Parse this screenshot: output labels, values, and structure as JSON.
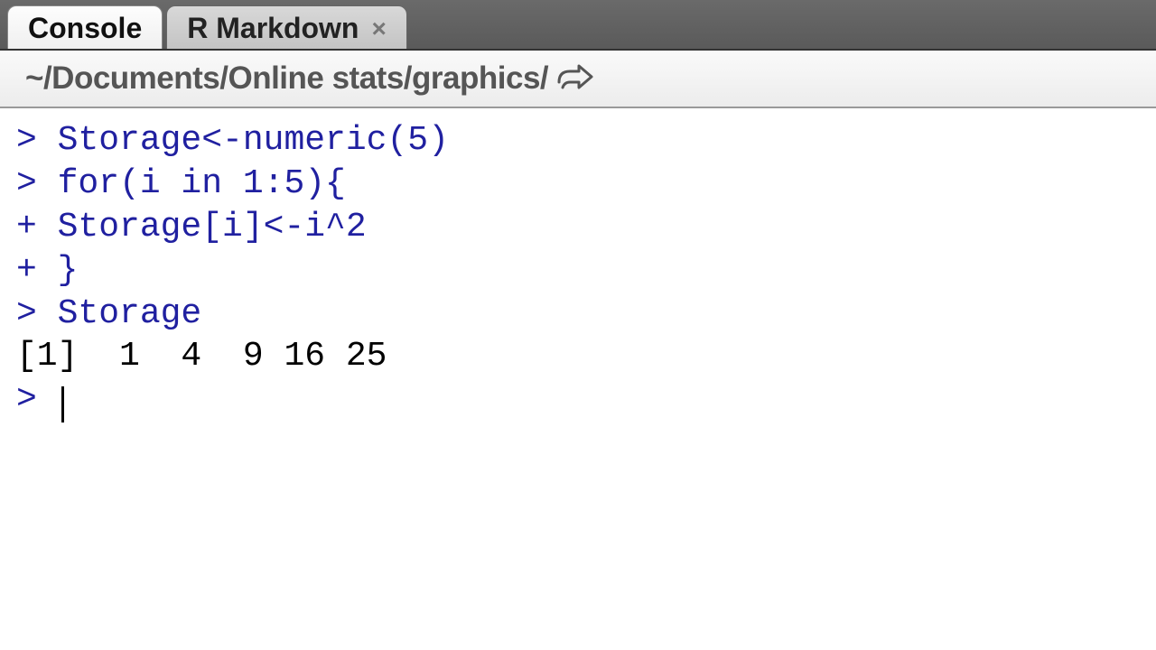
{
  "tabs": {
    "active": "Console",
    "inactive": "R Markdown"
  },
  "path": "~/Documents/Online stats/graphics/",
  "console": {
    "line1_prompt": "> ",
    "line1_code": "Storage<-numeric(5)",
    "line2_prompt": "> ",
    "line2_code": "for(i in 1:5){",
    "line3_prompt": "+ ",
    "line3_code": "Storage[i]<-i^2",
    "line4_prompt": "+ ",
    "line4_code": "}",
    "line5_prompt": "> ",
    "line5_code": "Storage",
    "output": "[1]  1  4  9 16 25",
    "line6_prompt": "> "
  }
}
